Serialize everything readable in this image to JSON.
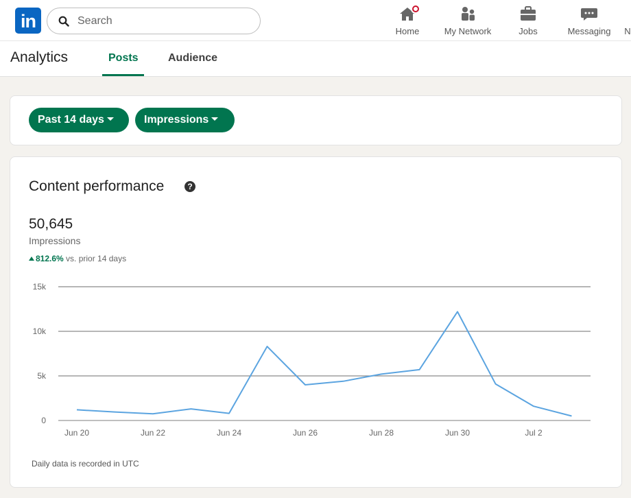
{
  "nav": {
    "logo_text": "in",
    "search_placeholder": "Search",
    "items": [
      {
        "label": "Home",
        "icon": "home-icon"
      },
      {
        "label": "My Network",
        "icon": "network-icon"
      },
      {
        "label": "Jobs",
        "icon": "briefcase-icon"
      },
      {
        "label": "Messaging",
        "icon": "messaging-icon"
      },
      {
        "label": "N",
        "icon": "notifications-icon"
      }
    ]
  },
  "subheader": {
    "title": "Analytics",
    "tabs": [
      {
        "label": "Posts",
        "active": true
      },
      {
        "label": "Audience",
        "active": false
      }
    ]
  },
  "filters": {
    "range": "Past 14 days",
    "metric": "Impressions"
  },
  "performance": {
    "title": "Content performance",
    "help_icon": "?",
    "total": "50,645",
    "total_label": "Impressions",
    "change_value": "812.6%",
    "change_text": "vs. prior 14 days",
    "footnote": "Daily data is recorded in UTC"
  },
  "colors": {
    "brand_blue": "#0a66c2",
    "accent_green": "#01754f",
    "line": "#5ba4e0",
    "notification": "#cb112d"
  },
  "chart_data": {
    "type": "line",
    "x": [
      "Jun 20",
      "Jun 21",
      "Jun 22",
      "Jun 23",
      "Jun 24",
      "Jun 25",
      "Jun 26",
      "Jun 27",
      "Jun 28",
      "Jun 29",
      "Jun 30",
      "Jul 1",
      "Jul 2",
      "Jul 3"
    ],
    "x_tick_labels": [
      "Jun 20",
      "Jun 22",
      "Jun 24",
      "Jun 26",
      "Jun 28",
      "Jun 30",
      "Jul 2"
    ],
    "series": [
      {
        "values": [
          1200,
          950,
          750,
          1300,
          800,
          8300,
          4000,
          4400,
          5200,
          5700,
          12200,
          4100,
          1600,
          500
        ]
      }
    ],
    "y_ticks": [
      0,
      5000,
      10000,
      15000
    ],
    "y_tick_labels": [
      "0",
      "5k",
      "10k",
      "15k"
    ],
    "ylim": [
      0,
      15000
    ],
    "grid": true,
    "legend": false
  }
}
